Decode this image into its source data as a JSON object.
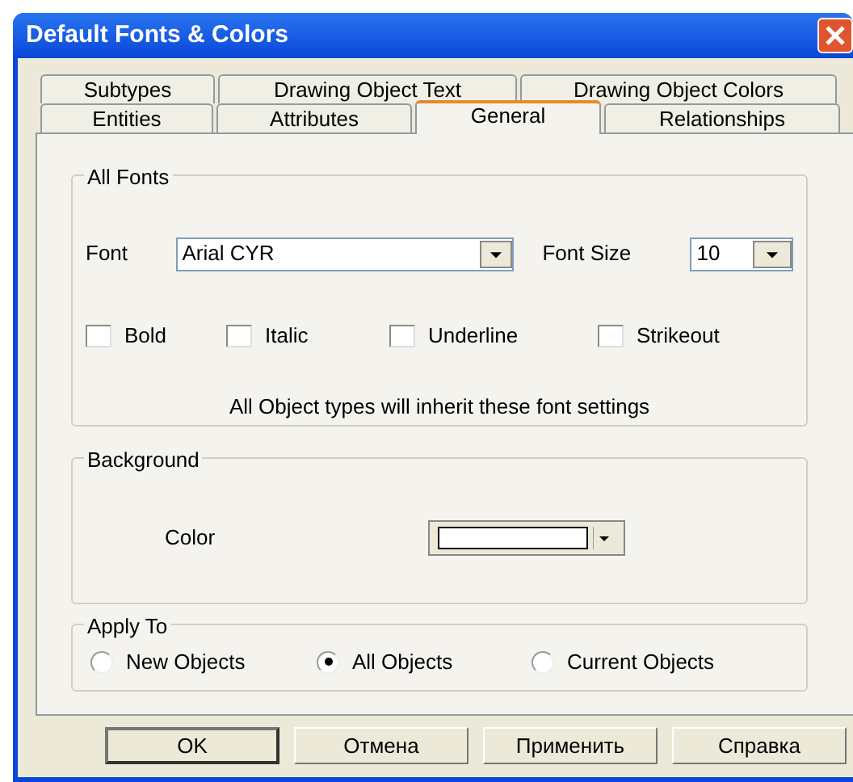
{
  "window": {
    "title": "Default Fonts & Colors"
  },
  "tab_rows": [
    [
      {
        "label": "Subtypes",
        "selected": false
      },
      {
        "label": "Drawing Object Text",
        "selected": false
      },
      {
        "label": "Drawing Object Colors",
        "selected": false
      }
    ],
    [
      {
        "label": "Entities",
        "selected": false
      },
      {
        "label": "Attributes",
        "selected": false
      },
      {
        "label": "General",
        "selected": true
      },
      {
        "label": "Relationships",
        "selected": false
      }
    ]
  ],
  "all_fonts": {
    "title": "All Fonts",
    "font_label": "Font",
    "font_value": "Arial CYR",
    "size_label": "Font Size",
    "size_value": "10",
    "styles": [
      {
        "label": "Bold",
        "checked": false
      },
      {
        "label": "Italic",
        "checked": false
      },
      {
        "label": "Underline",
        "checked": false
      },
      {
        "label": "Strikeout",
        "checked": false
      }
    ],
    "note": "All Object types will inherit these font settings"
  },
  "background": {
    "title": "Background",
    "color_label": "Color",
    "color": "#ffffff"
  },
  "apply_to": {
    "title": "Apply To",
    "options": [
      {
        "label": "New Objects",
        "selected": false
      },
      {
        "label": "All Objects",
        "selected": true
      },
      {
        "label": "Current Objects",
        "selected": false
      }
    ]
  },
  "buttons": [
    {
      "label": "OK",
      "default": true
    },
    {
      "label": "Отмена",
      "default": false
    },
    {
      "label": "Применить",
      "default": false
    },
    {
      "label": "Справка",
      "default": false
    }
  ]
}
